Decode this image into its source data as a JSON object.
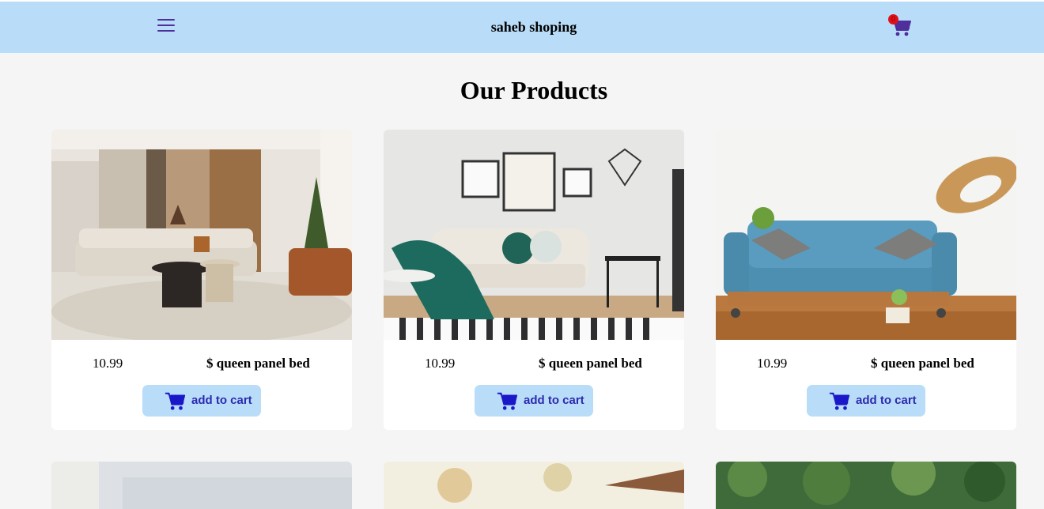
{
  "navbar": {
    "brand": "saheb shoping",
    "menu_icon": "hamburger-menu-icon",
    "cart_icon": "shopping-cart-icon",
    "cart_count": "0",
    "background": "#b9ddf8",
    "accent": "#4f2f9c"
  },
  "page": {
    "title": "Our Products"
  },
  "products": [
    {
      "price": "10.99",
      "name": "$ queen panel bed",
      "button": "add to cart",
      "image": "beige-living-room"
    },
    {
      "price": "10.99",
      "name": "$ queen panel bed",
      "button": "add to cart",
      "image": "scandinavian-sofa-room"
    },
    {
      "price": "10.99",
      "name": "$ queen panel bed",
      "button": "add to cart",
      "image": "blue-sofa"
    }
  ],
  "colors": {
    "button_bg": "#b9ddf8",
    "button_text": "#2c2ab0",
    "badge": "#e0101a"
  }
}
